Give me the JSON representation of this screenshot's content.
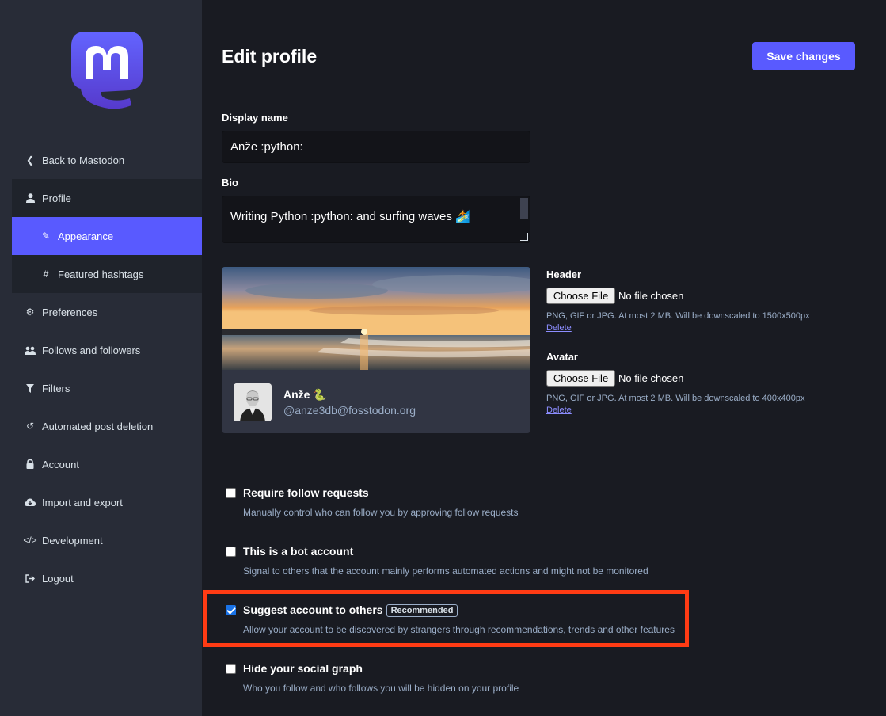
{
  "sidebar": {
    "items": [
      {
        "label": "Back to Mastodon",
        "icon": "chevron-left-icon"
      },
      {
        "label": "Profile",
        "icon": "user-icon"
      },
      {
        "label": "Appearance",
        "icon": "pencil-icon"
      },
      {
        "label": "Featured hashtags",
        "icon": "hashtag-icon"
      },
      {
        "label": "Preferences",
        "icon": "gear-icon"
      },
      {
        "label": "Follows and followers",
        "icon": "users-icon"
      },
      {
        "label": "Filters",
        "icon": "filter-icon"
      },
      {
        "label": "Automated post deletion",
        "icon": "history-icon"
      },
      {
        "label": "Account",
        "icon": "lock-icon"
      },
      {
        "label": "Import and export",
        "icon": "cloud-download-icon"
      },
      {
        "label": "Development",
        "icon": "code-icon"
      },
      {
        "label": "Logout",
        "icon": "sign-out-icon"
      }
    ]
  },
  "page": {
    "title": "Edit profile",
    "save_label": "Save changes"
  },
  "form": {
    "display_name_label": "Display name",
    "display_name_value": "Anže :python:",
    "bio_label": "Bio",
    "bio_value": "Writing Python :python: and surfing waves 🏄"
  },
  "preview": {
    "name": "Anže 🐍",
    "handle": "@anze3db@fosstodon.org"
  },
  "uploads": {
    "header": {
      "label": "Header",
      "button": "Choose File",
      "status": "No file chosen",
      "hint": "PNG, GIF or JPG. At most 2 MB. Will be downscaled to 1500x500px",
      "delete": "Delete"
    },
    "avatar": {
      "label": "Avatar",
      "button": "Choose File",
      "status": "No file chosen",
      "hint": "PNG, GIF or JPG. At most 2 MB. Will be downscaled to 400x400px",
      "delete": "Delete"
    }
  },
  "options": [
    {
      "title": "Require follow requests",
      "hint": "Manually control who can follow you by approving follow requests",
      "checked": false
    },
    {
      "title": "This is a bot account",
      "hint": "Signal to others that the account mainly performs automated actions and might not be monitored",
      "checked": false
    },
    {
      "title": "Suggest account to others",
      "badge": "Recommended",
      "hint": "Allow your account to be discovered by strangers through recommendations, trends and other features",
      "checked": true
    },
    {
      "title": "Hide your social graph",
      "hint": "Who you follow and who follows you will be hidden on your profile",
      "checked": false
    }
  ],
  "colors": {
    "accent": "#595aff",
    "highlight": "#ff3b14"
  }
}
